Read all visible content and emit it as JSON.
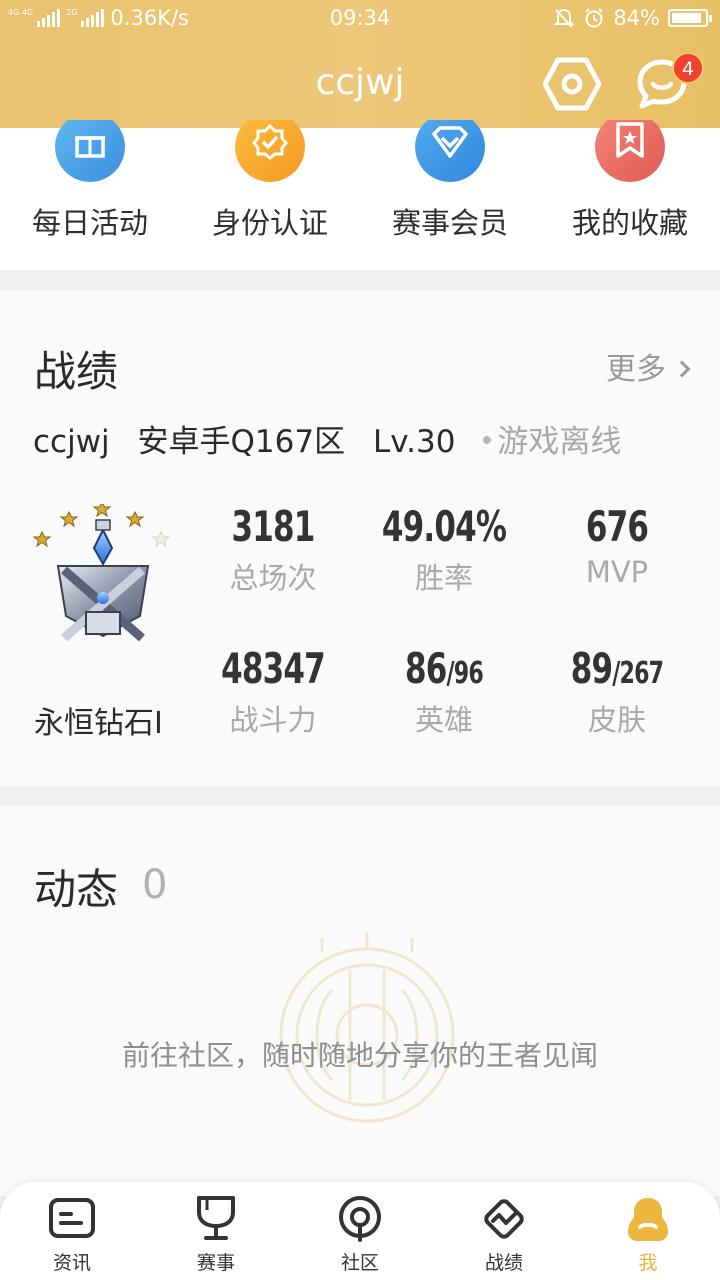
{
  "status_bar": {
    "net_tag_1": "4G 4G",
    "net_tag_2": "2G",
    "speed": "0.36K/s",
    "time": "09:34",
    "battery": "84%"
  },
  "header": {
    "title": "ccjwj",
    "message_badge": "4"
  },
  "quick_actions": [
    {
      "label": "每日活动",
      "icon": "gift-icon",
      "color": "#4fa3e6"
    },
    {
      "label": "身份认证",
      "icon": "verified-badge-icon",
      "color": "#f7a630"
    },
    {
      "label": "赛事会员",
      "icon": "diamond-icon",
      "color": "#3f9ae3"
    },
    {
      "label": "我的收藏",
      "icon": "bookmark-star-icon",
      "color": "#e8685f"
    }
  ],
  "stats_card": {
    "title": "战绩",
    "more": "更多",
    "player_name": "ccjwj",
    "server": "安卓手Q167区",
    "level": "Lv.30",
    "status": "游戏离线",
    "rank": "永恒钻石I",
    "rank_stars": 4,
    "rank_stars_total": 5,
    "items": [
      {
        "value": "3181",
        "label": "总场次"
      },
      {
        "value": "49.04%",
        "label": "胜率"
      },
      {
        "value": "676",
        "label": "MVP"
      },
      {
        "value": "48347",
        "label": "战斗力"
      },
      {
        "value": "86",
        "total": "/96",
        "label": "英雄"
      },
      {
        "value": "89",
        "total": "/267",
        "label": "皮肤"
      }
    ]
  },
  "feed": {
    "title": "动态",
    "count": "0",
    "empty_text": "前往社区，随时随地分享你的王者见闻"
  },
  "bottom_nav": [
    {
      "label": "资讯",
      "icon": "news-icon",
      "active": false
    },
    {
      "label": "赛事",
      "icon": "trophy-icon",
      "active": false
    },
    {
      "label": "社区",
      "icon": "community-icon",
      "active": false
    },
    {
      "label": "战绩",
      "icon": "stats-icon",
      "active": false
    },
    {
      "label": "我",
      "icon": "profile-icon",
      "active": true
    }
  ],
  "colors": {
    "header": "#ecc778",
    "accent": "#e9b33e",
    "badge": "#f1412c"
  }
}
